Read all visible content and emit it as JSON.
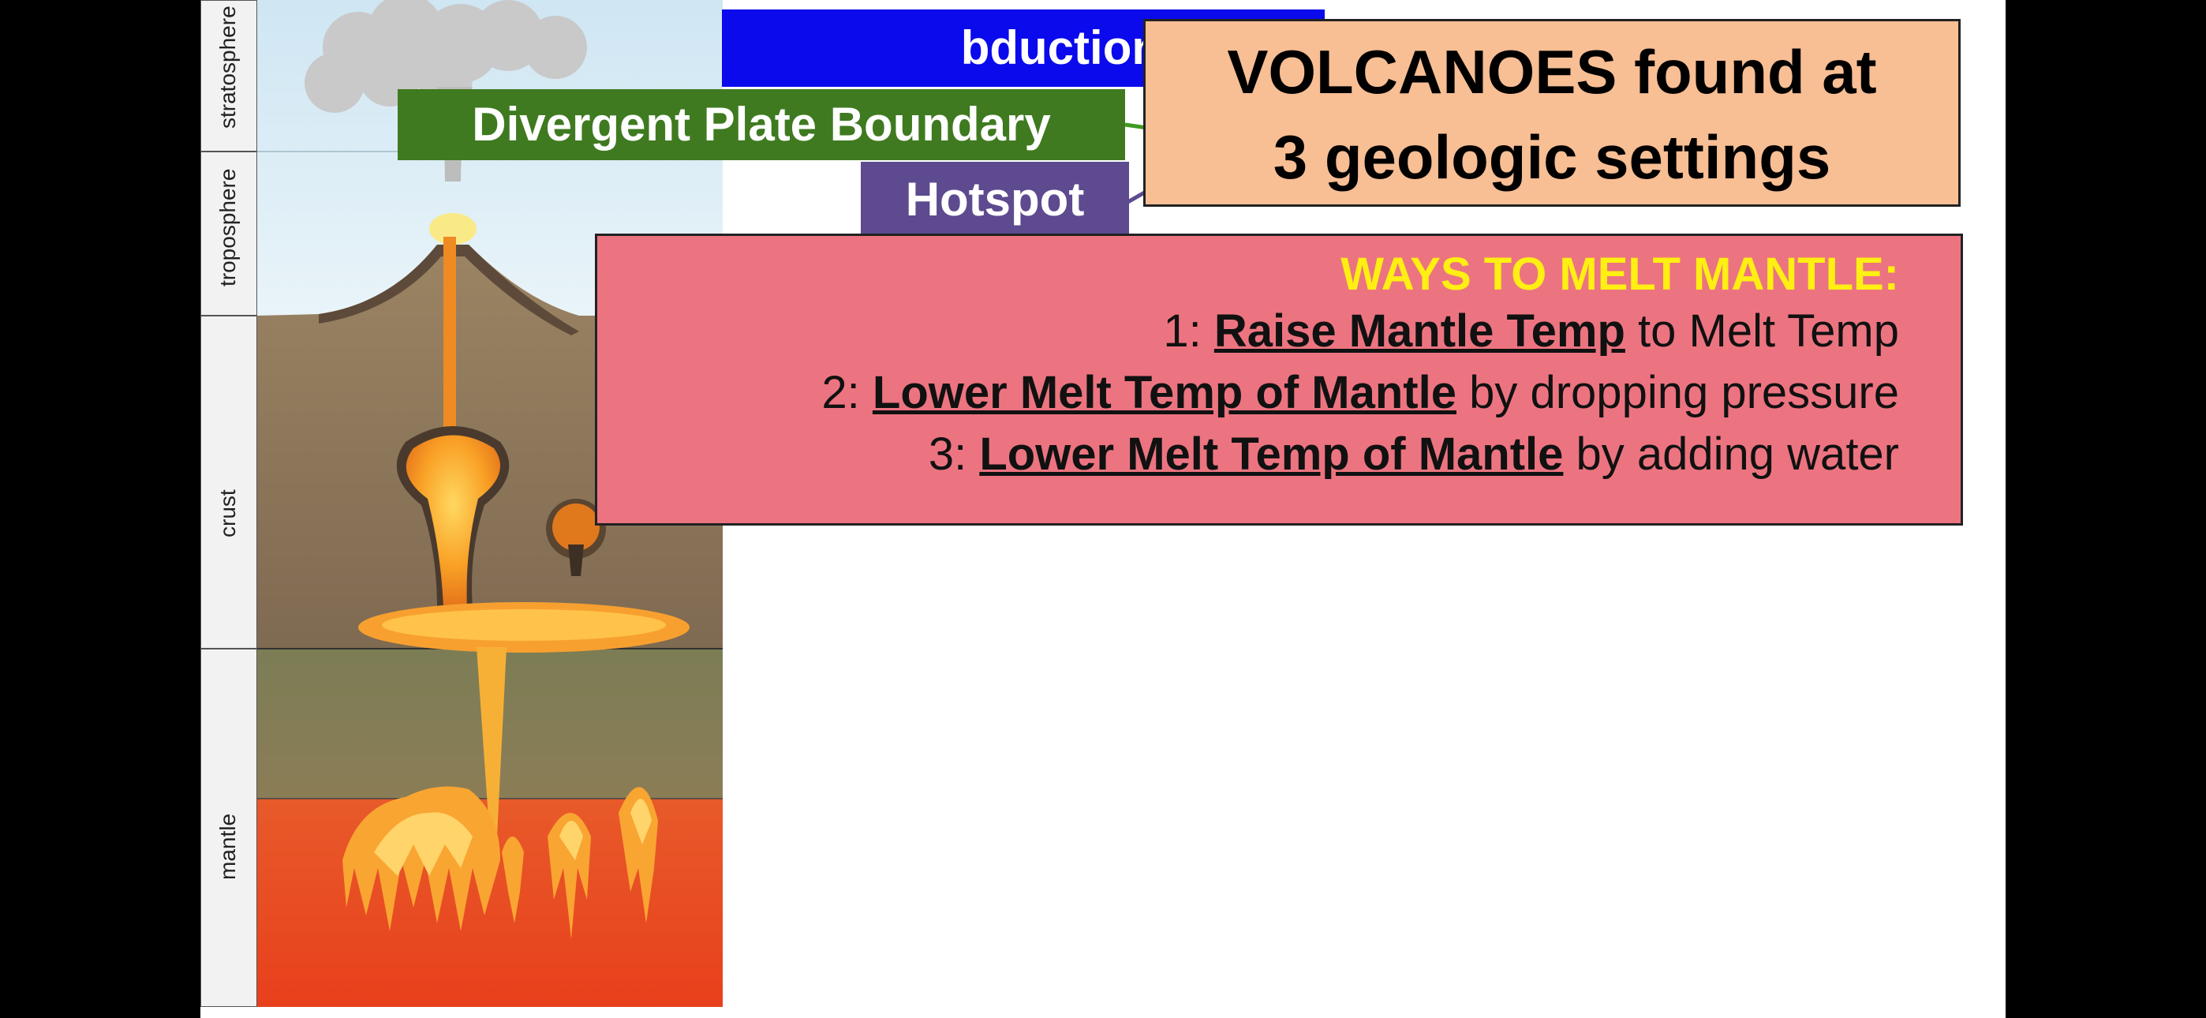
{
  "diagram": {
    "layers": [
      "stratosphere",
      "troposphere",
      "crust",
      "mantle"
    ]
  },
  "settings": {
    "subduction": "Subduction Zone",
    "subduction_visible": "bduction Zone",
    "divergent": "Divergent Plate Boundary",
    "hotspot": "Hotspot",
    "colors": {
      "subduction": "#0a0aec",
      "divergent": "#3f7a20",
      "hotspot": "#5d4a8f"
    }
  },
  "title": {
    "line1": "VOLCANOES found at",
    "line2": "3 geologic settings"
  },
  "ways": {
    "heading": "WAYS TO MELT MANTLE:",
    "items": [
      {
        "num": "1:",
        "bold": "Raise Mantle Temp",
        "rest": "to Melt Temp"
      },
      {
        "num": "2:",
        "bold": "Lower Melt Temp of Mantle",
        "rest": "by dropping pressure"
      },
      {
        "num": "3:",
        "bold": "Lower Melt Temp of Mantle",
        "rest": "by adding water"
      }
    ]
  }
}
